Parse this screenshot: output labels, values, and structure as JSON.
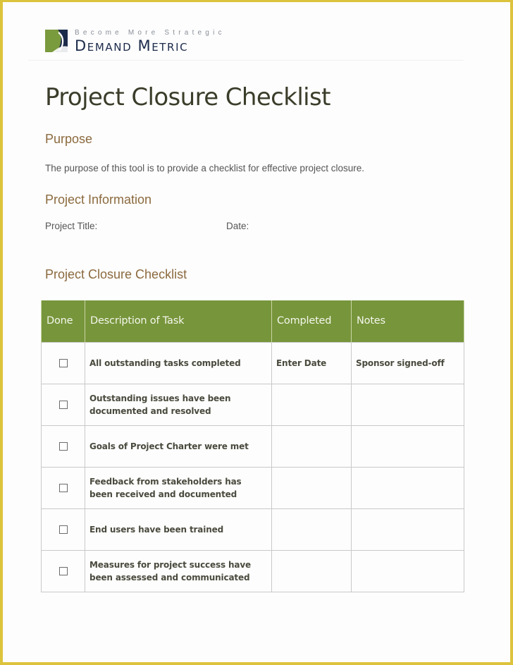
{
  "brand": {
    "tagline": "Become More Strategic",
    "name": "Demand Metric",
    "logo_icon": "demand-metric-logo",
    "colors": {
      "green": "#77953b",
      "navy": "#1b2a4a"
    }
  },
  "document": {
    "title": "Project Closure Checklist",
    "sections": {
      "purpose": {
        "heading": "Purpose",
        "text": "The purpose of this tool is to provide a checklist for effective project closure."
      },
      "project_information": {
        "heading": "Project Information",
        "fields": {
          "project_title_label": "Project Title:",
          "project_title_value": "",
          "date_label": "Date:",
          "date_value": ""
        }
      },
      "checklist": {
        "heading": "Project Closure Checklist"
      }
    }
  },
  "table": {
    "columns": [
      "Done",
      "Description of Task",
      "Completed",
      "Notes"
    ],
    "rows": [
      {
        "done": false,
        "task": "All outstanding tasks completed",
        "completed": "Enter Date",
        "notes": "Sponsor signed-off"
      },
      {
        "done": false,
        "task": "Outstanding issues have been documented and resolved",
        "completed": "",
        "notes": ""
      },
      {
        "done": false,
        "task": "Goals of Project Charter were met",
        "completed": "",
        "notes": ""
      },
      {
        "done": false,
        "task": "Feedback from stakeholders has been received and documented",
        "completed": "",
        "notes": ""
      },
      {
        "done": false,
        "task": "End users have been trained",
        "completed": "",
        "notes": ""
      },
      {
        "done": false,
        "task": "Measures for project success have been assessed and communicated",
        "completed": "",
        "notes": ""
      }
    ]
  },
  "colors": {
    "page_border": "#dcc33c",
    "header_fill": "#77953b",
    "section_heading": "#8b6a3e",
    "title_text": "#3b3d2a"
  }
}
